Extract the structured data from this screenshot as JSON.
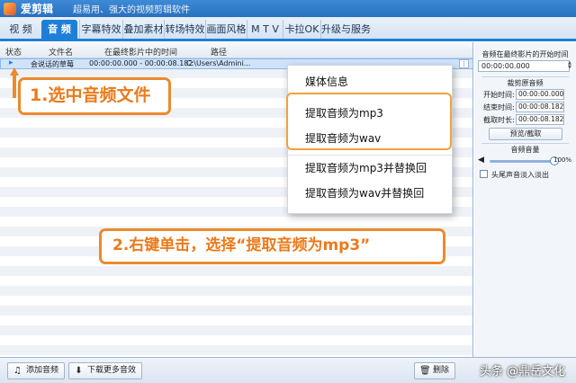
{
  "titlebar": {
    "app_name": "爱剪辑",
    "slogan": "超易用、强大的视频剪辑软件"
  },
  "tabs": [
    {
      "label": "视 频",
      "active": false
    },
    {
      "label": "音 频",
      "active": true
    },
    {
      "label": "字幕特效",
      "active": false
    },
    {
      "label": "叠加素材",
      "active": false
    },
    {
      "label": "转场特效",
      "active": false
    },
    {
      "label": "画面风格",
      "active": false
    },
    {
      "label": "M T V",
      "active": false
    },
    {
      "label": "卡拉OK",
      "active": false
    },
    {
      "label": "升级与服务",
      "active": false
    }
  ],
  "columns": {
    "status": "状态",
    "filename": "文件名",
    "time": "在最终影片中的时间",
    "path": "路径"
  },
  "selected_row": {
    "status_icon": "play-icon",
    "filename": "会说话的草莓",
    "time": "00:00:00.000 - 00:00:08.182",
    "path": "C:\\Users\\Admini..."
  },
  "context_menu": {
    "items": [
      "媒体信息",
      "提取音频为mp3",
      "提取音频为wav",
      "提取音频为mp3并替换回",
      "提取音频为wav并替换回"
    ]
  },
  "callouts": {
    "step1": "1.选中音频文件",
    "step2": "2.右键单击，选择“提取音频为mp3”"
  },
  "side_panel": {
    "start_title": "音频在最终影片的开始时间",
    "start_value": "00:00:00.000",
    "clip_title": "裁剪原音频",
    "start_label": "开始时间:",
    "start_time": "00:00:00.000",
    "end_label": "结束时间:",
    "end_time": "00:00:08.182",
    "dur_label": "截取时长:",
    "dur_time": "00:00:08.182",
    "preview_button": "预览/截取",
    "volume_title": "音频音量",
    "volume_percent": "100%",
    "volume_level": 1.0,
    "fade_label": "头尾声音淡入淡出"
  },
  "bottom": {
    "add_audio": "添加音频",
    "download_more": "下载更多音效",
    "delete": "删除"
  },
  "watermark": "头条 @鼎岳文化",
  "colors": {
    "accent": "#1f7fd8",
    "callout": "#ec8a2c"
  }
}
